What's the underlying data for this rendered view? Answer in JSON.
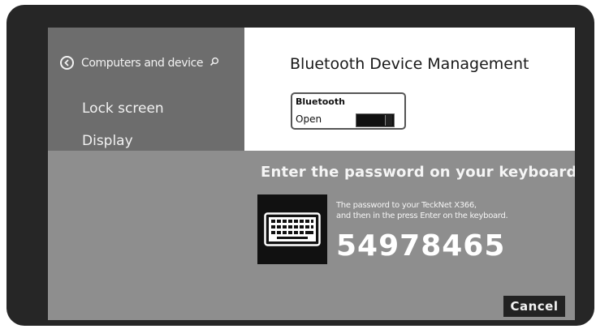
{
  "sidebar": {
    "back_label": "Computers and device",
    "back_icon": "back-arrow-icon",
    "search_icon": "search-icon",
    "items": [
      {
        "label": "Lock screen"
      },
      {
        "label": "Display"
      }
    ]
  },
  "panel": {
    "title": "Bluetooth Device Management",
    "toggle": {
      "title": "Bluetooth",
      "state_label": "Open"
    }
  },
  "pairing": {
    "prompt": "Enter the password on your keyboard",
    "keyboard_icon": "keyboard-icon",
    "instruction_line1": "The password to your TeckNet X366,",
    "instruction_line2": "and then in the press Enter on the keyboard.",
    "passkey": "54978465",
    "cancel_label": "Cancel"
  },
  "colors": {
    "bezel": "#262626",
    "sidebar_bg": "#6d6d6d",
    "screen_bg": "#8e8e8e",
    "panel_bg": "#ffffff",
    "tile_bg": "#111111"
  }
}
